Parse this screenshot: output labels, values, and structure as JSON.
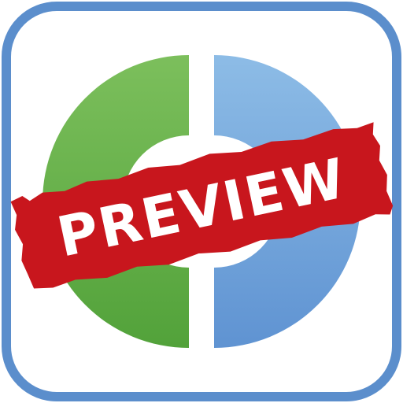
{
  "icon": {
    "frame_color": "#5b8ecc",
    "background_color": "#ffffff",
    "left_arc_color": "#6ab04c",
    "right_arc_color": "#78a9dd",
    "stamp_color": "#c8161d",
    "stamp_text_color": "#ffffff"
  },
  "stamp": {
    "label": "PREVIEW"
  }
}
